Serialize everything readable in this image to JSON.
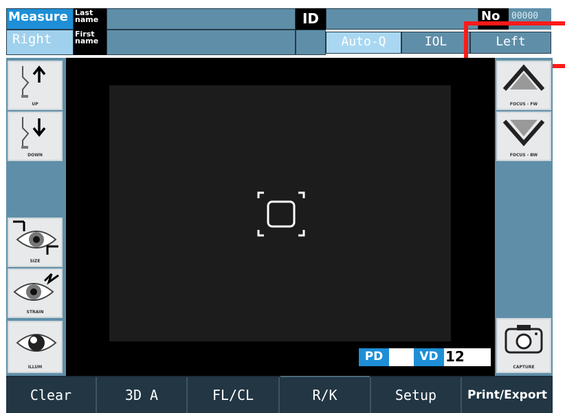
{
  "header": {
    "measure_label": "Measure",
    "right_label": "Right",
    "last_name_label": "Last name",
    "first_name_label": "First name",
    "id_label": "ID",
    "no_label": "No",
    "no_value": "00000",
    "autoq_label": "Auto-Q",
    "iol_label": "IOL",
    "left_label": "Left"
  },
  "left_panel": {
    "buttons": [
      {
        "name": "up",
        "caption": "UP",
        "icon": "chinrest-up-icon"
      },
      {
        "name": "down",
        "caption": "DOWN",
        "icon": "chinrest-down-icon"
      },
      {
        "name": "size",
        "caption": "SIZE",
        "icon": "eye-size-icon"
      },
      {
        "name": "strain",
        "caption": "STRAIN",
        "icon": "eye-strain-icon"
      },
      {
        "name": "illum",
        "caption": "ILLUM",
        "icon": "eye-illum-icon"
      }
    ]
  },
  "right_panel": {
    "buttons": [
      {
        "name": "focus-fw",
        "caption": "FOCUS - FW",
        "icon": "chevron-up-icon"
      },
      {
        "name": "focus-bw",
        "caption": "FOCUS - BW",
        "icon": "chevron-down-icon"
      },
      {
        "name": "capture",
        "caption": "CAPTURE",
        "icon": "camera-icon"
      }
    ]
  },
  "readouts": {
    "pd_label": "PD",
    "pd_value": "",
    "vd_label": "VD",
    "vd_value": "12"
  },
  "bottom_bar": {
    "clear": "Clear",
    "three_d_a": "3D A",
    "fl_cl": "FL/CL",
    "r_k": "R/K",
    "setup": "Setup",
    "print_export": "Print/Export"
  },
  "colors": {
    "accent": "#1e8fd6",
    "panel": "#5f8fa8",
    "highlight": "#ff1a1a"
  }
}
